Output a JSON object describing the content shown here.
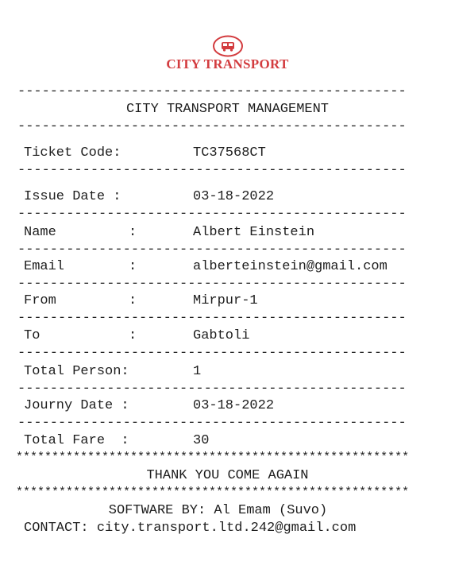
{
  "logo": {
    "text": "CITY TRANSPORT",
    "icon": "bus-icon",
    "color": "#d33c3f"
  },
  "dash_line": "------------------------------------------------",
  "dash_line_short": "------------------------------------------------",
  "star_line": "*******************************************************",
  "heading": "CITY TRANSPORT MANAGEMENT",
  "ticket_code": {
    "label": "Ticket Code:",
    "colon": "",
    "value": "TC37568CT"
  },
  "issue_date": {
    "label": "Issue Date :",
    "colon": "",
    "value": "03-18-2022"
  },
  "name": {
    "label": "Name",
    "colon": ":",
    "value": "Albert Einstein"
  },
  "email": {
    "label": "Email",
    "colon": ":",
    "value": "alberteinstein@gmail.com"
  },
  "from": {
    "label": "From",
    "colon": ":",
    "value": "Mirpur-1"
  },
  "to": {
    "label": "To",
    "colon": ":",
    "value": "Gabtoli"
  },
  "total_person": {
    "label": "Total Person:",
    "colon": "",
    "value": "1"
  },
  "journey_date": {
    "label": "Journy Date :",
    "colon": "",
    "value": "03-18-2022"
  },
  "total_fare": {
    "label": "Total Fare  :",
    "colon": "",
    "value": "30"
  },
  "thanks": "THANK YOU COME AGAIN",
  "software_by": "SOFTWARE BY: Al Emam (Suvo)",
  "contact": "CONTACT: city.transport.ltd.242@gmail.com"
}
